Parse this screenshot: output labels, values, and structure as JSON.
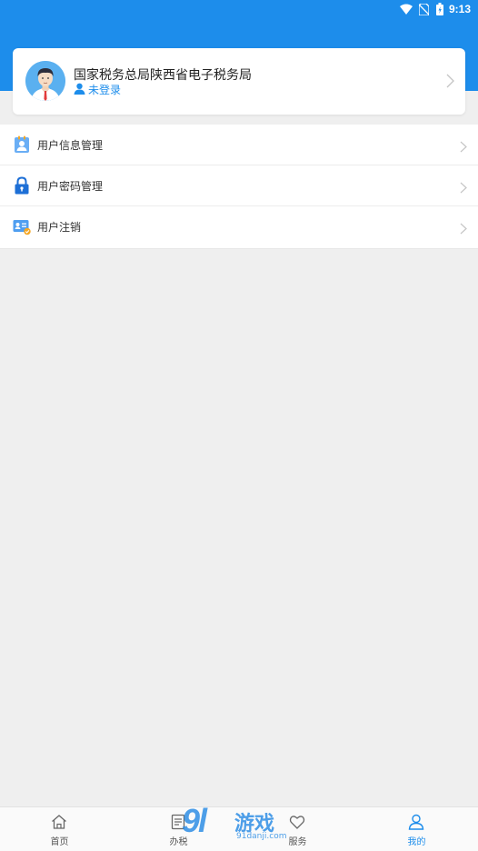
{
  "status_bar": {
    "time": "9:13",
    "icons": [
      "wifi-icon",
      "no-sim-icon",
      "battery-charging-icon"
    ]
  },
  "colors": {
    "primary": "#1d8deb",
    "background": "#efefef",
    "card": "#ffffff"
  },
  "profile": {
    "org_name": "国家税务总局陕西省电子税务局",
    "login_status": "未登录",
    "avatar_icon": "user-avatar-icon"
  },
  "menu": {
    "items": [
      {
        "label": "用户信息管理",
        "icon": "user-info-icon"
      },
      {
        "label": "用户密码管理",
        "icon": "lock-icon"
      },
      {
        "label": "用户注销",
        "icon": "id-card-icon"
      }
    ]
  },
  "tabbar": {
    "tabs": [
      {
        "label": "首页",
        "icon": "home-icon",
        "active": false
      },
      {
        "label": "办税",
        "icon": "list-icon",
        "active": false
      },
      {
        "label": "服务",
        "icon": "heart-icon",
        "active": false
      },
      {
        "label": "我的",
        "icon": "user-icon",
        "active": true
      }
    ]
  },
  "watermark": {
    "logo": "9l",
    "text": "游戏",
    "url": "91danji.com"
  }
}
